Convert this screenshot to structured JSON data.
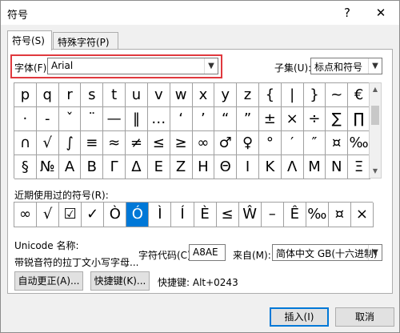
{
  "window": {
    "title": "符号",
    "help": "?",
    "close": "✕"
  },
  "tabs": [
    "符号(S)",
    "特殊字符(P)"
  ],
  "font": {
    "label": "字体(F):",
    "value": "Arial"
  },
  "subset": {
    "label": "子集(U):",
    "value": "标点和符号"
  },
  "symbol_grid": [
    [
      "p",
      "q",
      "r",
      "s",
      "t",
      "u",
      "v",
      "w",
      "x",
      "y",
      "z",
      "{",
      "|",
      "}",
      "~",
      "€"
    ],
    [
      "·",
      "‐",
      "ˇ",
      "¨",
      "—",
      "‖",
      "…",
      "‘",
      "’",
      "“",
      "”",
      "±",
      "×",
      "÷",
      "∑",
      "∏"
    ],
    [
      "∩",
      "√",
      "∫",
      "≡",
      "≈",
      "≠",
      "≤",
      "≥",
      "∞",
      "♂",
      "♀",
      "°",
      "′",
      "″",
      "¤",
      "‰"
    ],
    [
      "§",
      "№",
      "Α",
      "Β",
      "Γ",
      "Δ",
      "Ε",
      "Ζ",
      "Η",
      "Θ",
      "Ι",
      "Κ",
      "Λ",
      "Μ",
      "Ν",
      "Ξ"
    ]
  ],
  "recent": {
    "label": "近期使用过的符号(R):",
    "symbols": [
      "∞",
      "√",
      "☑",
      "✓",
      "Ò",
      "Ó",
      "Ì",
      "Í",
      "È",
      "≤",
      "Ŵ",
      "–",
      "Ê",
      "‰",
      "¤",
      "×"
    ],
    "selected_index": 5
  },
  "unicode": {
    "label": "Unicode 名称:",
    "desc": "带锐音符的拉丁文小写字母..."
  },
  "char_code": {
    "label": "字符代码(C):",
    "value": "A8AE"
  },
  "from": {
    "label": "来自(M):",
    "value": "简体中文 GB(十六进制)"
  },
  "buttons": {
    "autocorrect": "自动更正(A)...",
    "shortcut": "快捷键(K)...",
    "shortcut_text": "快捷键: Alt+0243",
    "insert": "插入(I)",
    "cancel": "取消"
  }
}
